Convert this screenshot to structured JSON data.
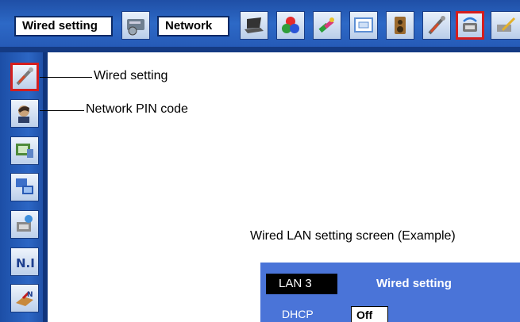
{
  "topbar": {
    "wired_setting_label": "Wired setting",
    "network_label": "Network",
    "icons": [
      "settings-icon",
      "laptop-icon",
      "color-icon",
      "image-adjust-icon",
      "screen-icon",
      "speaker-icon",
      "tools-icon",
      "network-icon",
      "setup-icon"
    ],
    "selected_icon": "network-icon"
  },
  "sidebar": {
    "icons": [
      "wired-setting-icon",
      "network-pin-code-icon",
      "network-info-icon",
      "network-computers-icon",
      "network-setup-icon",
      "network-information-icon",
      "exit-icon"
    ],
    "selected_icon": "wired-setting-icon"
  },
  "callouts": {
    "wired_setting": "Wired setting",
    "network_pin_code": "Network PIN code"
  },
  "caption": "Wired LAN setting screen (Example)",
  "example_screen": {
    "lan_label": "LAN 3",
    "title": "Wired setting",
    "dhcp_label": "DHCP",
    "dhcp_value": "Off"
  },
  "colors": {
    "menu_blue": "#2d69c6",
    "selection_red": "#d41e1e",
    "example_blue": "#4a74d8"
  }
}
